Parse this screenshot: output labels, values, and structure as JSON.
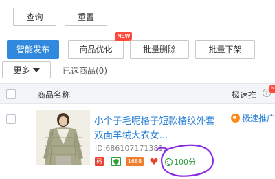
{
  "toolbar": {
    "query_label": "查询",
    "reset_label": "重置"
  },
  "actions": {
    "smart_publish_label": "智能发布",
    "optimize_label": "商品优化",
    "new_badge": "NEW",
    "batch_delete_label": "批量删除",
    "batch_offshelf_label": "批量下架",
    "more_label": "更多",
    "selected_text": "已选商品(0)"
  },
  "table": {
    "headers": {
      "name": "商品名称",
      "speed_promo": "极速推",
      "hot_badge": "NEW"
    },
    "rows": [
      {
        "title_line1": "小个子毛呢格子短款格纹外套",
        "title_line2": "双面羊绒大衣女...",
        "id_text": "ID:686107171381",
        "tags": [
          "码",
          "",
          "1688",
          ""
        ],
        "score": "100分",
        "speed_promo_label": "极速推广"
      }
    ]
  },
  "colors": {
    "primary": "#3089dc",
    "link": "#2a82d8",
    "new_badge": "#ff4a3b",
    "score": "#2e9e3b",
    "annotation": "#8a2be2"
  }
}
